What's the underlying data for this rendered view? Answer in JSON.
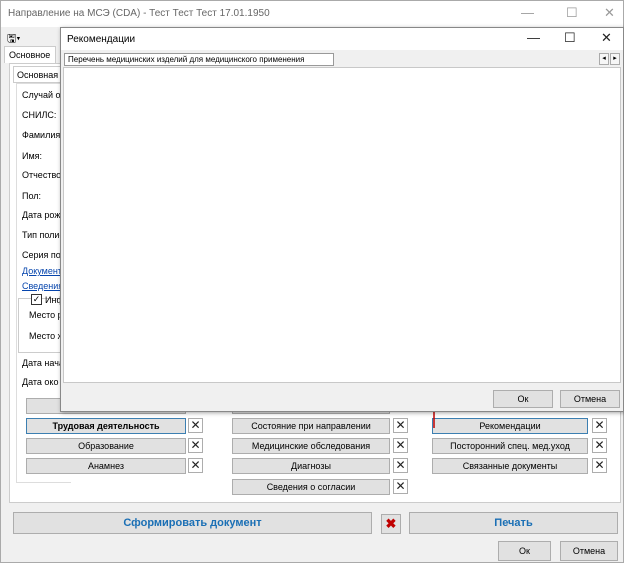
{
  "main_window": {
    "title": "Направление на МСЭ (CDA) - Тест Тест Тест 17.01.1950",
    "tabs": [
      "Основное"
    ],
    "inner_tab": "Основная и",
    "labels": {
      "case": "Случай об",
      "snils": "СНИЛС:",
      "surname": "Фамилия",
      "name": "Имя:",
      "patronymic": "Отчество:",
      "sex": "Пол:",
      "birthdate": "Дата рожд",
      "policy_type": "Тип полис",
      "series": "Серия по",
      "documents_link": "Документ",
      "info_link": "Сведения",
      "info_check": "Инф",
      "place_r": "Место р",
      "place_zh": "Место ж",
      "start_date": "Дата нача",
      "end_date": "Дата око"
    },
    "sections_left": [
      "Трудовая деятельность",
      "Образование",
      "Анамнез"
    ],
    "sections_mid": [
      "Состояние при направлении",
      "Медицинские обследования",
      "Диагнозы",
      "Сведения о согласии"
    ],
    "sections_right": [
      "Рекомендации",
      "Посторонний спец. мед.уход",
      "Связанные документы"
    ],
    "generate_label": "Сформировать документ",
    "print_label": "Печать",
    "ok_label": "Ок",
    "cancel_label": "Отмена"
  },
  "dialog": {
    "title": "Рекомендации",
    "tab_label": "Перечень медицинских изделий для медицинского применения",
    "ok_label": "Ок",
    "cancel_label": "Отмена"
  },
  "colors": {
    "link": "#0645ad",
    "accent_blue": "#1a6fb5",
    "arrow": "#c00000"
  }
}
